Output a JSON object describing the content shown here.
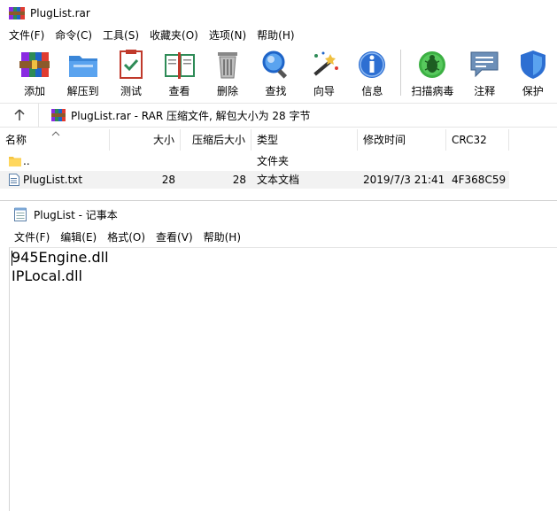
{
  "window": {
    "title": "PlugList.rar"
  },
  "menu": [
    "文件(F)",
    "命令(C)",
    "工具(S)",
    "收藏夹(O)",
    "选项(N)",
    "帮助(H)"
  ],
  "toolbar": [
    {
      "label": "添加",
      "icon": "add-archive-icon"
    },
    {
      "label": "解压到",
      "icon": "extract-to-icon"
    },
    {
      "label": "测试",
      "icon": "test-icon"
    },
    {
      "label": "查看",
      "icon": "view-icon"
    },
    {
      "label": "删除",
      "icon": "delete-icon"
    },
    {
      "label": "查找",
      "icon": "find-icon"
    },
    {
      "label": "向导",
      "icon": "wizard-icon"
    },
    {
      "label": "信息",
      "icon": "info-icon"
    },
    {
      "label": "扫描病毒",
      "icon": "virus-scan-icon"
    },
    {
      "label": "注释",
      "icon": "comment-icon"
    },
    {
      "label": "保护",
      "icon": "protect-icon"
    }
  ],
  "address": {
    "text": "PlugList.rar - RAR 压缩文件, 解包大小为 28 字节"
  },
  "columns": {
    "name": "名称",
    "size": "大小",
    "packed": "压缩后大小",
    "type": "类型",
    "modified": "修改时间",
    "crc": "CRC32"
  },
  "files": [
    {
      "name": "..",
      "size": "",
      "packed": "",
      "type": "文件夹",
      "modified": "",
      "crc": ""
    },
    {
      "name": "PlugList.txt",
      "size": "28",
      "packed": "28",
      "type": "文本文档",
      "modified": "2019/7/3 21:41",
      "crc": "4F368C59"
    }
  ],
  "notepad": {
    "title": "PlugList - 记事本",
    "menu": [
      "文件(F)",
      "编辑(E)",
      "格式(O)",
      "查看(V)",
      "帮助(H)"
    ],
    "lines": [
      "945Engine.dll",
      "IPLocal.dll"
    ]
  },
  "colors": {
    "accent_blue": "#1e64c8",
    "folder": "#f5c542",
    "selected_row": "#f2f2f2"
  }
}
